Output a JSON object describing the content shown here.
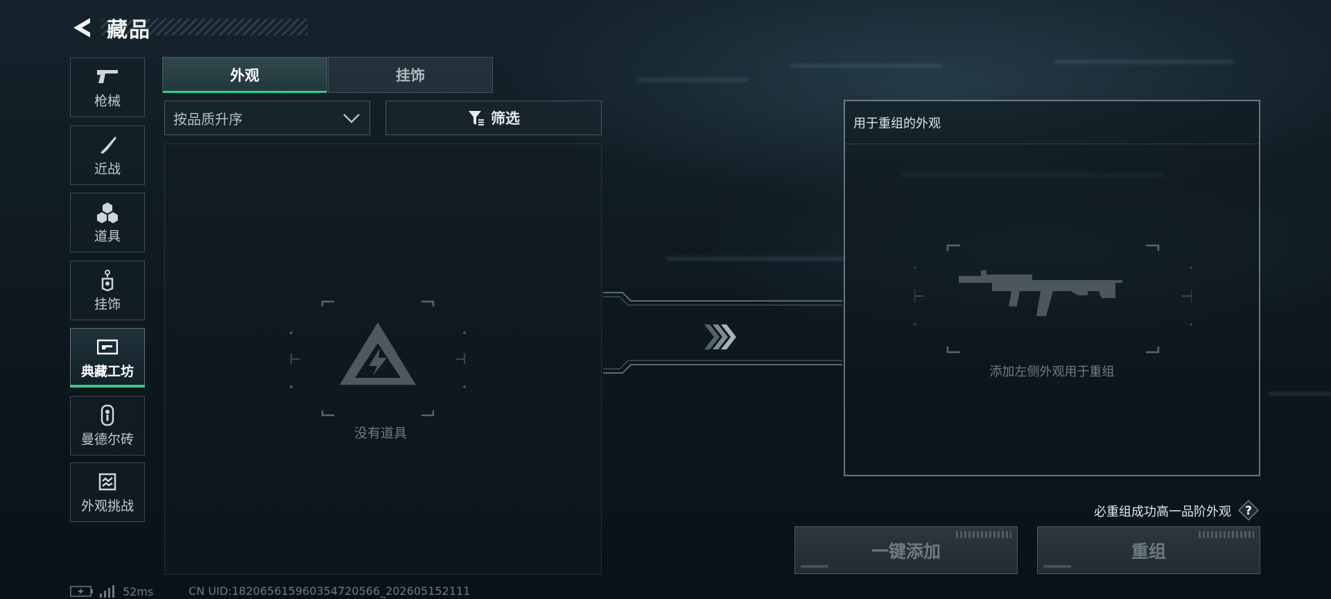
{
  "header": {
    "title": "藏品"
  },
  "sidebar": {
    "items": [
      {
        "label": "枪械",
        "icon": "pistol-icon"
      },
      {
        "label": "近战",
        "icon": "knife-icon"
      },
      {
        "label": "道具",
        "icon": "grenades-icon"
      },
      {
        "label": "挂饰",
        "icon": "charm-icon"
      },
      {
        "label": "典藏工坊",
        "icon": "workshop-icon",
        "active": true
      },
      {
        "label": "曼德尔砖",
        "icon": "brick-icon"
      },
      {
        "label": "外观挑战",
        "icon": "challenge-icon"
      }
    ]
  },
  "tabs": [
    {
      "label": "外观",
      "active": true
    },
    {
      "label": "挂饰",
      "active": false
    }
  ],
  "sort": {
    "label": "按品质升序"
  },
  "filter": {
    "label": "筛选"
  },
  "item_list": {
    "empty_text": "没有道具"
  },
  "reforge": {
    "header": "用于重组的外观",
    "hint": "添加左侧外观用于重组"
  },
  "guarantee_note": "必重组成功高一品阶外观",
  "buttons": {
    "add_all": "一键添加",
    "reforge": "重组"
  },
  "status": {
    "ping": "52ms",
    "uid": "CN UID:182065615960354720566_202605152111"
  },
  "colors": {
    "accent": "#2fcf8a",
    "panel_border": "#b4c3cd"
  }
}
